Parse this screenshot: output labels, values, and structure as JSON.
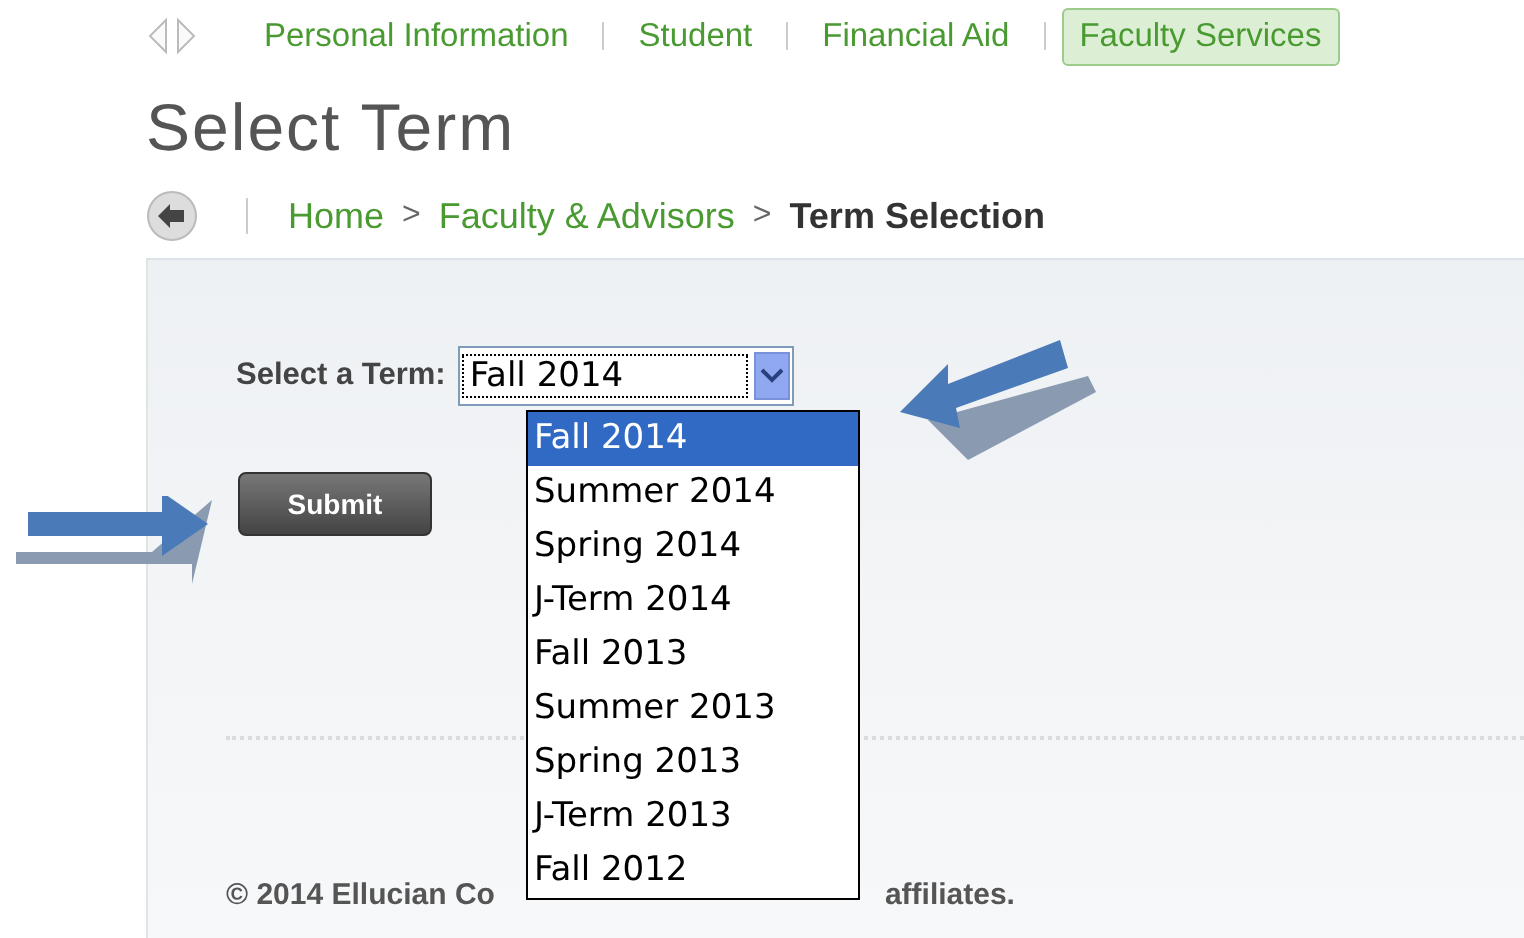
{
  "tabs": [
    {
      "label": "Personal Information",
      "selected": false
    },
    {
      "label": "Student",
      "selected": false
    },
    {
      "label": "Financial Aid",
      "selected": false
    },
    {
      "label": "Faculty Services",
      "selected": true
    }
  ],
  "page_title": "Select Term",
  "breadcrumb": {
    "links": [
      "Home",
      "Faculty & Advisors"
    ],
    "separator": ">",
    "current": "Term Selection"
  },
  "form": {
    "label": "Select a Term:",
    "value": "Fall 2014",
    "submit": "Submit",
    "options": [
      {
        "label": "Fall 2014",
        "selected": true
      },
      {
        "label": "Summer 2014",
        "selected": false
      },
      {
        "label": "Spring 2014",
        "selected": false
      },
      {
        "label": "J-Term 2014",
        "selected": false
      },
      {
        "label": "Fall 2013",
        "selected": false
      },
      {
        "label": "Summer 2013",
        "selected": false
      },
      {
        "label": "Spring 2013",
        "selected": false
      },
      {
        "label": "J-Term 2013",
        "selected": false
      },
      {
        "label": "Fall 2012",
        "selected": false
      }
    ]
  },
  "footer": [
    "© 2014 Ellucian Co",
    "affiliates."
  ]
}
